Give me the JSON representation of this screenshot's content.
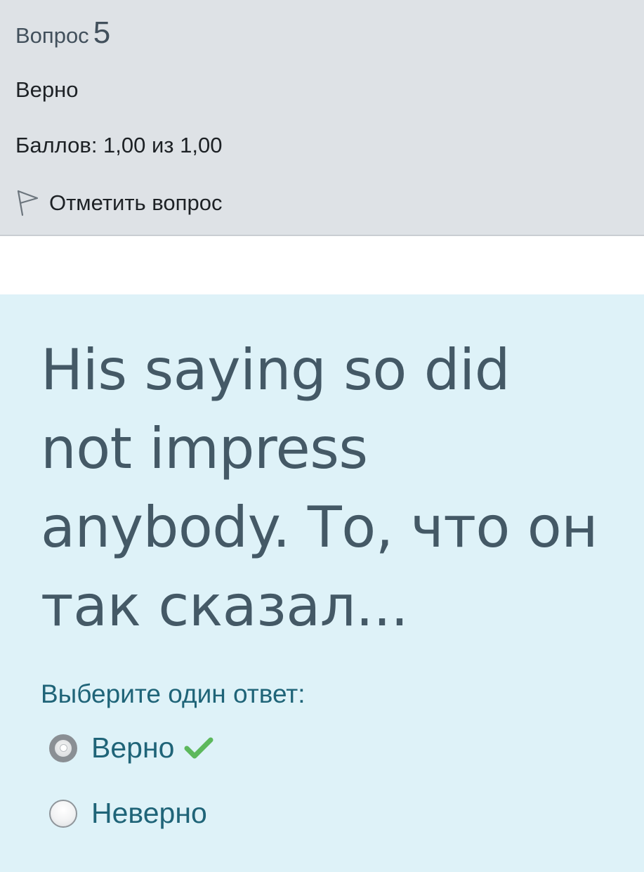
{
  "info": {
    "question_word": "Вопрос",
    "question_number": "5",
    "state": "Верно",
    "grade": "Баллов: 1,00 из 1,00",
    "flag_label": "Отметить вопрос"
  },
  "question": {
    "text": "His saying so did not impress anybody. То, что он так сказал...",
    "prompt": "Выберите один ответ:",
    "answers": [
      {
        "label": "Верно",
        "selected": true,
        "correct": true
      },
      {
        "label": "Неверно",
        "selected": false,
        "correct": false
      }
    ]
  },
  "colors": {
    "info_background": "#dee2e6",
    "content_background": "#def2f8",
    "correct_check": "#5cb85c"
  },
  "icons": {
    "flag": "flag-icon",
    "correct": "check-icon"
  }
}
